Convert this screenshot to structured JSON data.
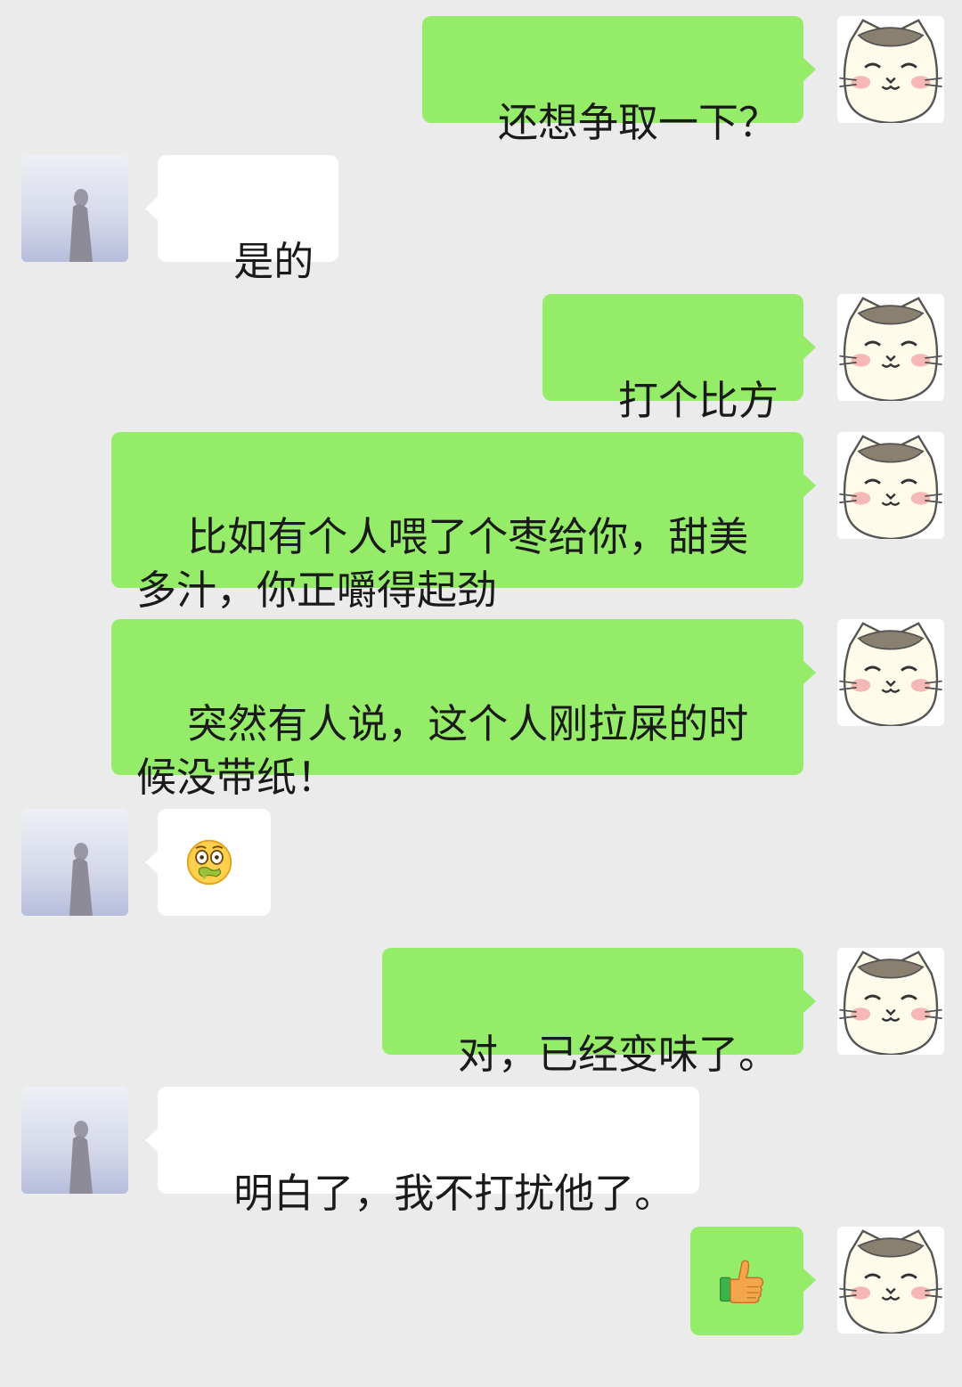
{
  "chat": {
    "messages": [
      {
        "sender": "me",
        "type": "text",
        "text": "还想争取一下？"
      },
      {
        "sender": "contact",
        "type": "text",
        "text": "是的"
      },
      {
        "sender": "me",
        "type": "text",
        "text": "打个比方"
      },
      {
        "sender": "me",
        "type": "text",
        "text": "比如有个人喂了个枣给你，甜美多汁，你正嚼得起劲"
      },
      {
        "sender": "me",
        "type": "text",
        "text": "突然有人说，这个人刚拉屎的时候没带纸！"
      },
      {
        "sender": "contact",
        "type": "emoji",
        "icon": "nauseated-face-icon"
      },
      {
        "sender": "me",
        "type": "text",
        "text": "对，已经变味了。"
      },
      {
        "sender": "contact",
        "type": "text",
        "text": "明白了，我不打扰他了。"
      },
      {
        "sender": "me",
        "type": "emoji",
        "icon": "thumbs-up-icon"
      }
    ]
  },
  "colors": {
    "background": "#ebebeb",
    "outgoing_bubble": "#95ec69",
    "incoming_bubble": "#ffffff"
  },
  "avatars": {
    "me": "cat-avatar",
    "contact": "silhouette-avatar"
  }
}
